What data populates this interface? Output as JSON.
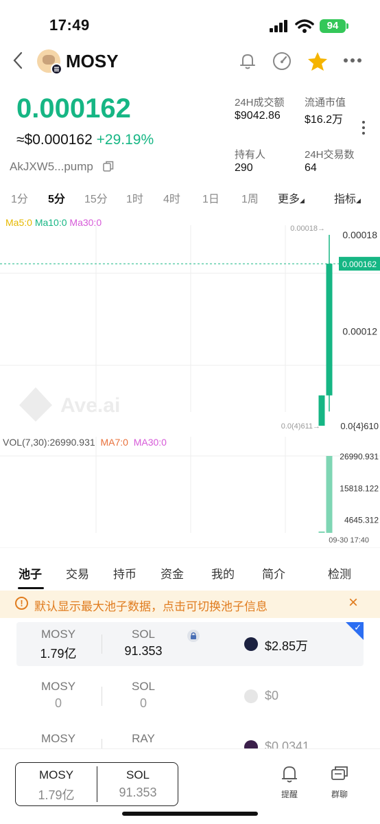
{
  "status": {
    "time": "17:49",
    "battery": "94"
  },
  "header": {
    "token_name": "MOSY",
    "back_icon": "chevron-left-icon"
  },
  "price": {
    "main": "0.000162",
    "usd": "≈$0.000162",
    "change": "+29.19%",
    "address": "AkJXW5...pump"
  },
  "stats": [
    {
      "label": "24H成交额",
      "value": "$9042.86"
    },
    {
      "label": "流通市值",
      "value": "$16.2万"
    },
    {
      "label": "持有人",
      "value": "290"
    },
    {
      "label": "24H交易数",
      "value": "64"
    }
  ],
  "timeframes": [
    "1分",
    "5分",
    "15分",
    "1时",
    "4时",
    "1日",
    "1周",
    "更多",
    "指标"
  ],
  "active_timeframe": "5分",
  "ma_legend": {
    "ma5": "Ma5:0",
    "ma10": "Ma10:0",
    "ma30": "Ma30:0"
  },
  "vol_legend": {
    "vol": "VOL(7,30):26990.931",
    "ma7": "MA7:0",
    "ma30": "MA30:0"
  },
  "chart_data": {
    "type": "candlestick",
    "price_axis_labels": [
      "0.00018",
      "0.000162",
      "0.00012",
      "0.0{4}610"
    ],
    "current_price_tag": "0.000162",
    "high_marker": "0.00018→",
    "low_marker": "0.0(4)611→",
    "watermark": "Ave.ai",
    "candles": [
      {
        "open": 6.11e-05,
        "close": 8e-05,
        "high": 8e-05,
        "low": 6.11e-05
      },
      {
        "open": 8e-05,
        "close": 0.000162,
        "high": 0.00018,
        "low": 7e-05
      }
    ],
    "volume_axis_labels": [
      "26990.931",
      "15818.122",
      "4645.312"
    ],
    "volume": [
      0,
      26990.931
    ],
    "time_label": "09-30 17:40",
    "colors": {
      "up": "#16b684",
      "ma5": "#e6b800",
      "ma10": "#16b684",
      "ma30": "#d65ad8"
    }
  },
  "tabs": [
    "池子",
    "交易",
    "持币",
    "资金",
    "我的",
    "简介",
    "检测"
  ],
  "notice": {
    "text": "默认显示最大池子数据，点击可切换池子信息"
  },
  "pools": [
    {
      "base": "MOSY",
      "base_amount": "1.79亿",
      "quote": "SOL",
      "quote_amount": "91.353",
      "liquidity": "$2.85万",
      "dex_icon": "raydium-icon",
      "selected": true
    },
    {
      "base": "MOSY",
      "base_amount": "0",
      "quote": "SOL",
      "quote_amount": "0",
      "liquidity": "$0",
      "dex_icon": "dex-icon",
      "selected": false
    },
    {
      "base": "MOSY",
      "base_amount": "",
      "quote": "RAY",
      "quote_amount": "",
      "liquidity": "$0.0341",
      "dex_icon": "dex-icon",
      "selected": false
    }
  ],
  "bottom": {
    "pair": {
      "base": "MOSY",
      "base_amount": "1.79亿",
      "quote": "SOL",
      "quote_amount": "91.353"
    },
    "alert_label": "提醒",
    "chat_label": "群聊"
  }
}
